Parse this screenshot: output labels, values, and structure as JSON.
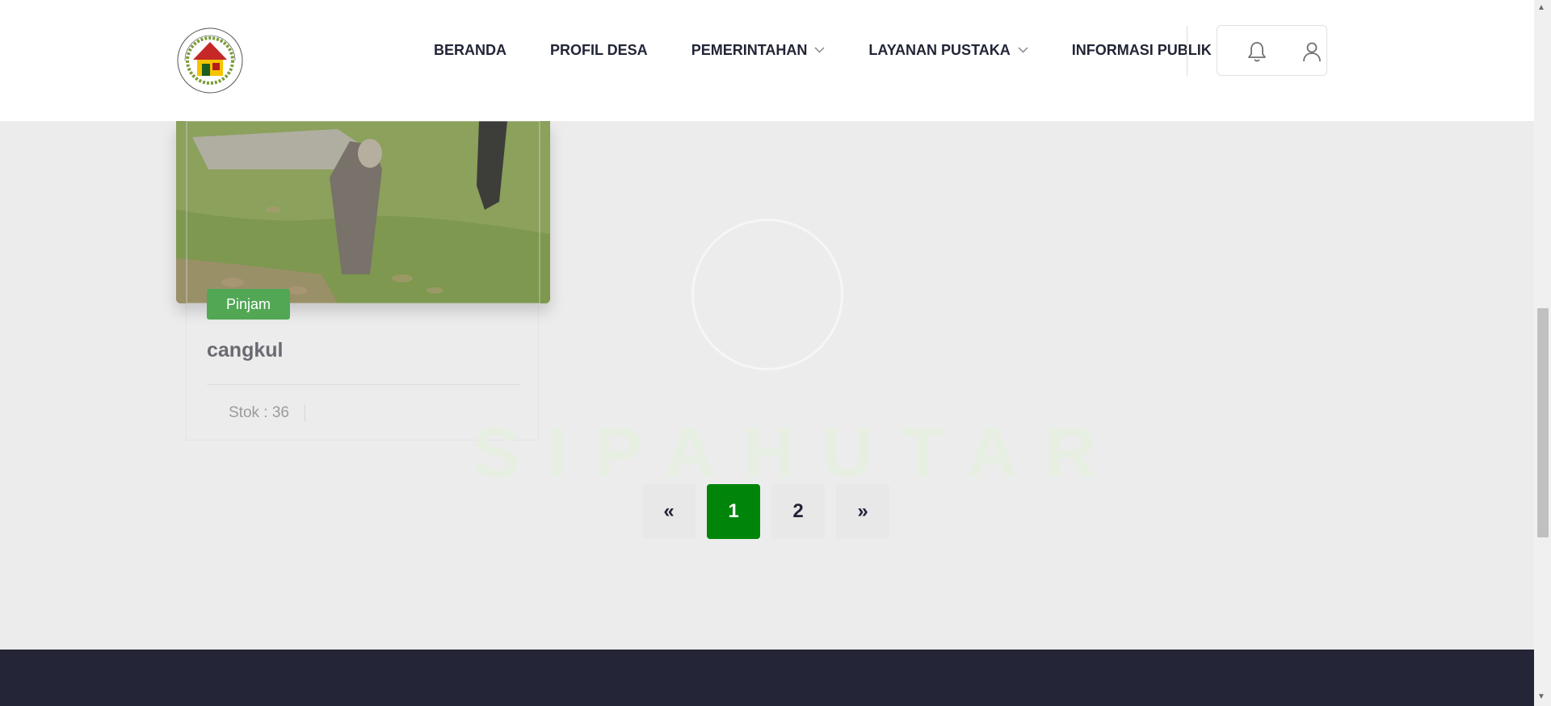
{
  "header": {
    "logo_text": "SISTEM INFORMASI DESA SIPAHUTAR",
    "nav": [
      {
        "label": "BERANDA",
        "has_dropdown": false
      },
      {
        "label": "PROFIL DESA",
        "has_dropdown": false
      },
      {
        "label": "PEMERINTAHAN",
        "has_dropdown": true
      },
      {
        "label": "LAYANAN PUSTAKA",
        "has_dropdown": true
      },
      {
        "label": "INFORMASI PUBLIK",
        "has_dropdown": true
      }
    ],
    "icons": [
      "bell-icon",
      "user-icon"
    ]
  },
  "card": {
    "badge": "Pinjam",
    "title": "cangkul",
    "stock": "Stok : 36"
  },
  "watermark": "SIPAHUTAR",
  "pagination": {
    "prev": "«",
    "pages": [
      "1",
      "2"
    ],
    "active_page": "1",
    "next": "»"
  },
  "colors": {
    "accent": "#00850a",
    "badge": "#52a755",
    "nav_text": "#222536",
    "footer": "#242537"
  },
  "scrollbar": {
    "up_arrow": "▲",
    "down_arrow": "▼"
  }
}
